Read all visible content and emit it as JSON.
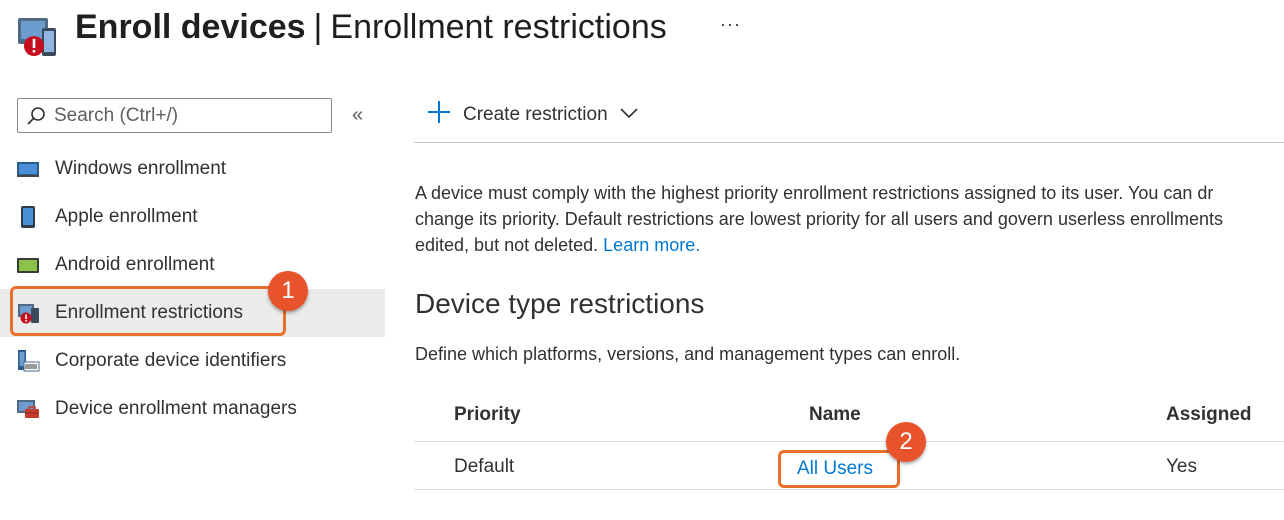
{
  "header": {
    "title_main": "Enroll devices",
    "separator": "|",
    "title_sub": "Enrollment restrictions",
    "more_label": "···"
  },
  "sidebar": {
    "search_placeholder": "Search (Ctrl+/)",
    "collapse_label": "«",
    "items": [
      {
        "label": "Windows enrollment"
      },
      {
        "label": "Apple enrollment"
      },
      {
        "label": "Android enrollment"
      },
      {
        "label": "Enrollment restrictions",
        "selected": true
      },
      {
        "label": "Corporate device identifiers"
      },
      {
        "label": "Device enrollment managers"
      }
    ]
  },
  "toolbar": {
    "create_icon": "+",
    "create_label": "Create restriction"
  },
  "main": {
    "description_line1": "A device must comply with the highest priority enrollment restrictions assigned to its user. You can dr",
    "description_line2": "change its priority. Default restrictions are lowest priority for all users and govern userless enrollments",
    "description_line3": "edited, but not deleted.",
    "learn_more": "Learn more.",
    "section_title": "Device type restrictions",
    "section_description": "Define which platforms, versions, and management types can enroll."
  },
  "table": {
    "columns": [
      "Priority",
      "Name",
      "Assigned"
    ],
    "rows": [
      {
        "priority": "Default",
        "name": "All Users",
        "assigned": "Yes"
      }
    ]
  },
  "annotations": {
    "callout_1": "1",
    "callout_2": "2"
  },
  "colors": {
    "accent": "#0078d4",
    "callout": "#e9532b",
    "selected_bg": "#ebebeb"
  }
}
